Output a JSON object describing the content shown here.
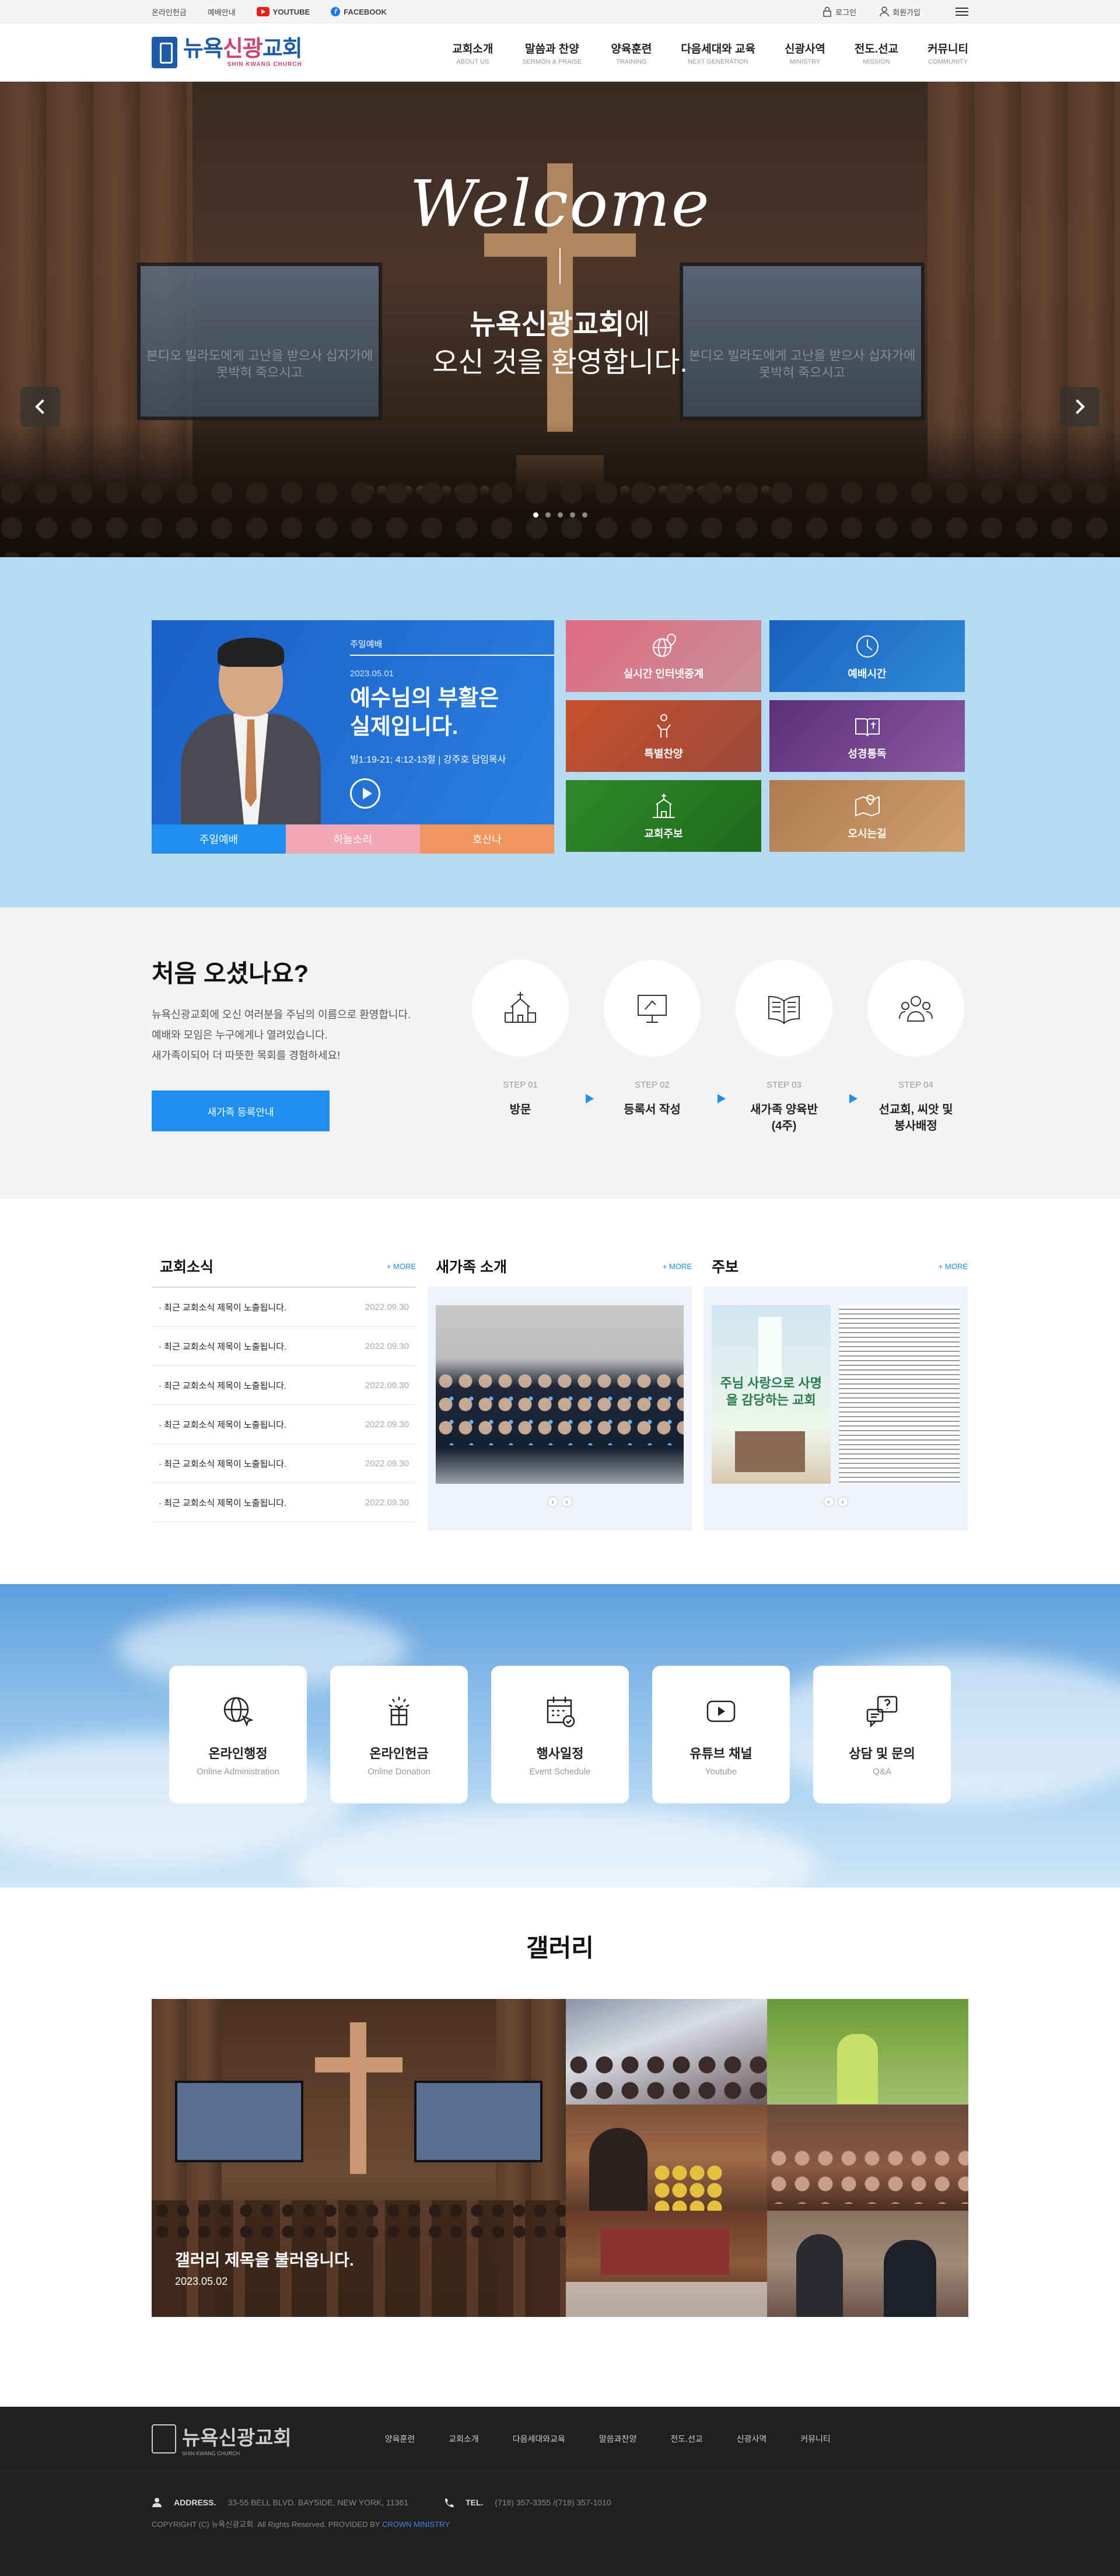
{
  "topbar": {
    "links": [
      "온라인헌금",
      "예배안내"
    ],
    "youtube": "YOUTUBE",
    "facebook": "FACEBOOK",
    "login": "로그인",
    "join": "회원가입"
  },
  "header": {
    "logo_main": "뉴욕",
    "logo_accent": "신광",
    "logo_tail": "교회",
    "logo_sub": "SHIN KWANG CHURCH",
    "nav": [
      {
        "ko": "교회소개",
        "en": "ABOUT US"
      },
      {
        "ko": "말씀과 찬양",
        "en": "SERMON & PRAISE"
      },
      {
        "ko": "양육훈련",
        "en": "TRAINING"
      },
      {
        "ko": "다음세대와 교육",
        "en": "NEXT GENERATION"
      },
      {
        "ko": "신광사역",
        "en": "MINISTRY"
      },
      {
        "ko": "전도.선교",
        "en": "MISSION"
      },
      {
        "ko": "커뮤니티",
        "en": "COMMUNITY"
      }
    ]
  },
  "hero": {
    "welcome": "Welcome",
    "title_bold": "뉴욕신광교회",
    "title_rest": "에",
    "subtitle": "오신 것을 환영합니다.",
    "screen_text": "본디오 빌라도에게 고난을 받으사 십자가에 못박혀 죽으시고",
    "slides": 5,
    "active_slide": 1
  },
  "sermon": {
    "label": "주일예배",
    "date": "2023.05.01",
    "title_line1": "예수님의 부활은",
    "title_line2": "실제입니다.",
    "reference": "빌1:19-21; 4:12-13절 | 강주호 담임목사",
    "tabs": [
      {
        "label": "주일예배",
        "color": "#1e8fef"
      },
      {
        "label": "하늘소리",
        "color": "#f2a6b6"
      },
      {
        "label": "호산나",
        "color": "#f0955e"
      }
    ],
    "quick": [
      {
        "label": "실시간 인터넷중계",
        "icon": "globe-pin-icon",
        "color1": "#e06a80",
        "color2": "#c8909a"
      },
      {
        "label": "예배시간",
        "icon": "clock-icon",
        "color1": "#1a5fc0",
        "color2": "#2f8ad6"
      },
      {
        "label": "특별찬양",
        "icon": "praise-hands-icon",
        "color1": "#c8502c",
        "color2": "#9a4a3a"
      },
      {
        "label": "성경통독",
        "icon": "bible-icon",
        "color1": "#5a2e7a",
        "color2": "#8a5aa0"
      },
      {
        "label": "교회주보",
        "icon": "church-icon",
        "color1": "#2f8a2a",
        "color2": "#1e6a1a"
      },
      {
        "label": "오시는길",
        "icon": "map-pin-icon",
        "color1": "#b07a4a",
        "color2": "#d0a070"
      }
    ]
  },
  "visit": {
    "title": "처음 오셨나요?",
    "lines": [
      "뉴욕신광교회에 오신 여러분을 주님의 이름으로 환영합니다.",
      "예배와 모임은 누구에게나 열려있습니다.",
      "새가족이되어 더 따뜻한 목회를 경험하세요!"
    ],
    "button": "새가족 등록안내",
    "steps": [
      {
        "num": "STEP 01",
        "name": "방문",
        "icon": "church-building-icon"
      },
      {
        "num": "STEP 02",
        "name": "등록서 작성",
        "icon": "monitor-icon"
      },
      {
        "num": "STEP 03",
        "name": "새가족 양육반 (4주)",
        "icon": "open-book-icon"
      },
      {
        "num": "STEP 04",
        "name": "선교회, 씨앗 및 봉사배정",
        "icon": "people-group-icon"
      }
    ]
  },
  "news": {
    "col1_title": "교회소식",
    "col2_title": "새가족 소개",
    "col3_title": "주보",
    "more": "+ MORE",
    "items": [
      {
        "title": "· 최근 교회소식 제목이 노출됩니다.",
        "date": "2022.09.30"
      },
      {
        "title": "· 최근 교회소식 제목이 노출됩니다.",
        "date": "2022.09.30"
      },
      {
        "title": "· 최근 교회소식 제목이 노출됩니다.",
        "date": "2022.09.30"
      },
      {
        "title": "· 최근 교회소식 제목이 노출됩니다.",
        "date": "2022.09.30"
      },
      {
        "title": "· 최근 교회소식 제목이 노출됩니다.",
        "date": "2022.09.30"
      },
      {
        "title": "· 최근 교회소식 제목이 노출됩니다.",
        "date": "2022.09.30"
      }
    ],
    "bulletin_text": "주님 사랑으로 사명을 감당하는 교회"
  },
  "quicklinks": [
    {
      "ko": "온라인행정",
      "en": "Online Administration",
      "icon": "globe-cursor-icon"
    },
    {
      "ko": "온라인헌금",
      "en": "Online Donation",
      "icon": "donation-icon"
    },
    {
      "ko": "행사일정",
      "en": "Event Schedule",
      "icon": "calendar-icon"
    },
    {
      "ko": "유튜브 채널",
      "en": "Youtube",
      "icon": "youtube-icon"
    },
    {
      "ko": "상담 및 문의",
      "en": "Q&A",
      "icon": "chat-question-icon"
    }
  ],
  "gallery": {
    "title": "갤러리",
    "caption_title": "갤러리 제목을 불러옵니다.",
    "caption_date": "2023.05.02"
  },
  "footer": {
    "logo": "뉴욕신광교회",
    "logo_sub": "SHIN KWANG CHURCH",
    "nav": [
      "양육훈련",
      "교회소개",
      "다음세대와교육",
      "말씀과찬양",
      "전도.선교",
      "신광사역",
      "커뮤니티"
    ],
    "address_label": "ADDRESS.",
    "address": "33-55 BELL BLVD. BAYSIDE, NEW YORK, 11361",
    "tel_label": "TEL.",
    "tel": "(718) 357-3355 /(718) 357-1010",
    "copyright": "COPYRIGHT (C) 뉴욕신광교회. All Rights Reserved. PROVIDED BY",
    "provider": "CROWN MINISTRY"
  }
}
